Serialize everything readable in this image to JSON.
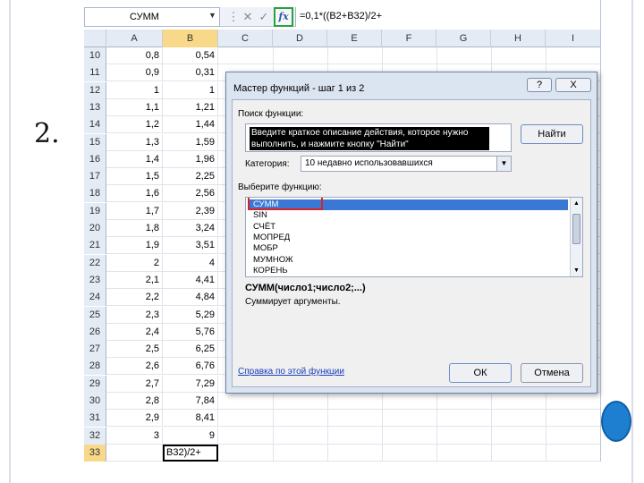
{
  "slide": {
    "step_label": "2."
  },
  "formula_bar": {
    "name_box": "СУММ",
    "cancel_glyph": "✕",
    "enter_glyph": "✓",
    "fx_label": "fx",
    "formula": "=0,1*((B2+B32)/2+"
  },
  "columns": [
    "A",
    "B",
    "C",
    "D",
    "E",
    "F",
    "G",
    "H",
    "I"
  ],
  "rows": [
    {
      "num": "10",
      "a": "0,8",
      "b": "0,54"
    },
    {
      "num": "11",
      "a": "0,9",
      "b": "0,31"
    },
    {
      "num": "12",
      "a": "1",
      "b": "1"
    },
    {
      "num": "13",
      "a": "1,1",
      "b": "1,21"
    },
    {
      "num": "14",
      "a": "1,2",
      "b": "1,44"
    },
    {
      "num": "15",
      "a": "1,3",
      "b": "1,59"
    },
    {
      "num": "16",
      "a": "1,4",
      "b": "1,96"
    },
    {
      "num": "17",
      "a": "1,5",
      "b": "2,25"
    },
    {
      "num": "18",
      "a": "1,6",
      "b": "2,56"
    },
    {
      "num": "19",
      "a": "1,7",
      "b": "2,39"
    },
    {
      "num": "20",
      "a": "1,8",
      "b": "3,24"
    },
    {
      "num": "21",
      "a": "1,9",
      "b": "3,51"
    },
    {
      "num": "22",
      "a": "2",
      "b": "4"
    },
    {
      "num": "23",
      "a": "2,1",
      "b": "4,41"
    },
    {
      "num": "24",
      "a": "2,2",
      "b": "4,84"
    },
    {
      "num": "25",
      "a": "2,3",
      "b": "5,29"
    },
    {
      "num": "26",
      "a": "2,4",
      "b": "5,76"
    },
    {
      "num": "27",
      "a": "2,5",
      "b": "6,25"
    },
    {
      "num": "28",
      "a": "2,6",
      "b": "6,76"
    },
    {
      "num": "29",
      "a": "2,7",
      "b": "7,29"
    },
    {
      "num": "30",
      "a": "2,8",
      "b": "7,84"
    },
    {
      "num": "31",
      "a": "2,9",
      "b": "8,41"
    },
    {
      "num": "32",
      "a": "3",
      "b": "9"
    },
    {
      "num": "33",
      "a": "",
      "b": "B32)/2+"
    }
  ],
  "dialog": {
    "title": "Мастер функций - шаг 1 из 2",
    "help_glyph": "?",
    "close_glyph": "X",
    "search_label": "Поиск функции:",
    "search_text": "Введите краткое описание действия, которое нужно выполнить, и нажмите кнопку \"Найти\"",
    "find_button": "Найти",
    "category_label": "Категория:",
    "category_value": "10 недавно использовавшихся",
    "select_label": "Выберите функцию:",
    "functions": [
      "СУММ",
      "SIN",
      "СЧЁТ",
      "МОПРЕД",
      "МОБР",
      "МУМНОЖ",
      "КОРЕНЬ"
    ],
    "selected_function": "СУММ",
    "signature": "СУММ(число1;число2;...)",
    "description": "Суммирует аргументы.",
    "help_link": "Справка по этой функции",
    "ok_button": "ОК",
    "cancel_button": "Отмена"
  },
  "colors": {
    "fx_highlight": "#27a33a",
    "selection_highlight": "#d42525",
    "selected_item": "#3a78d4",
    "accent_circle": "#1e7fd0"
  }
}
